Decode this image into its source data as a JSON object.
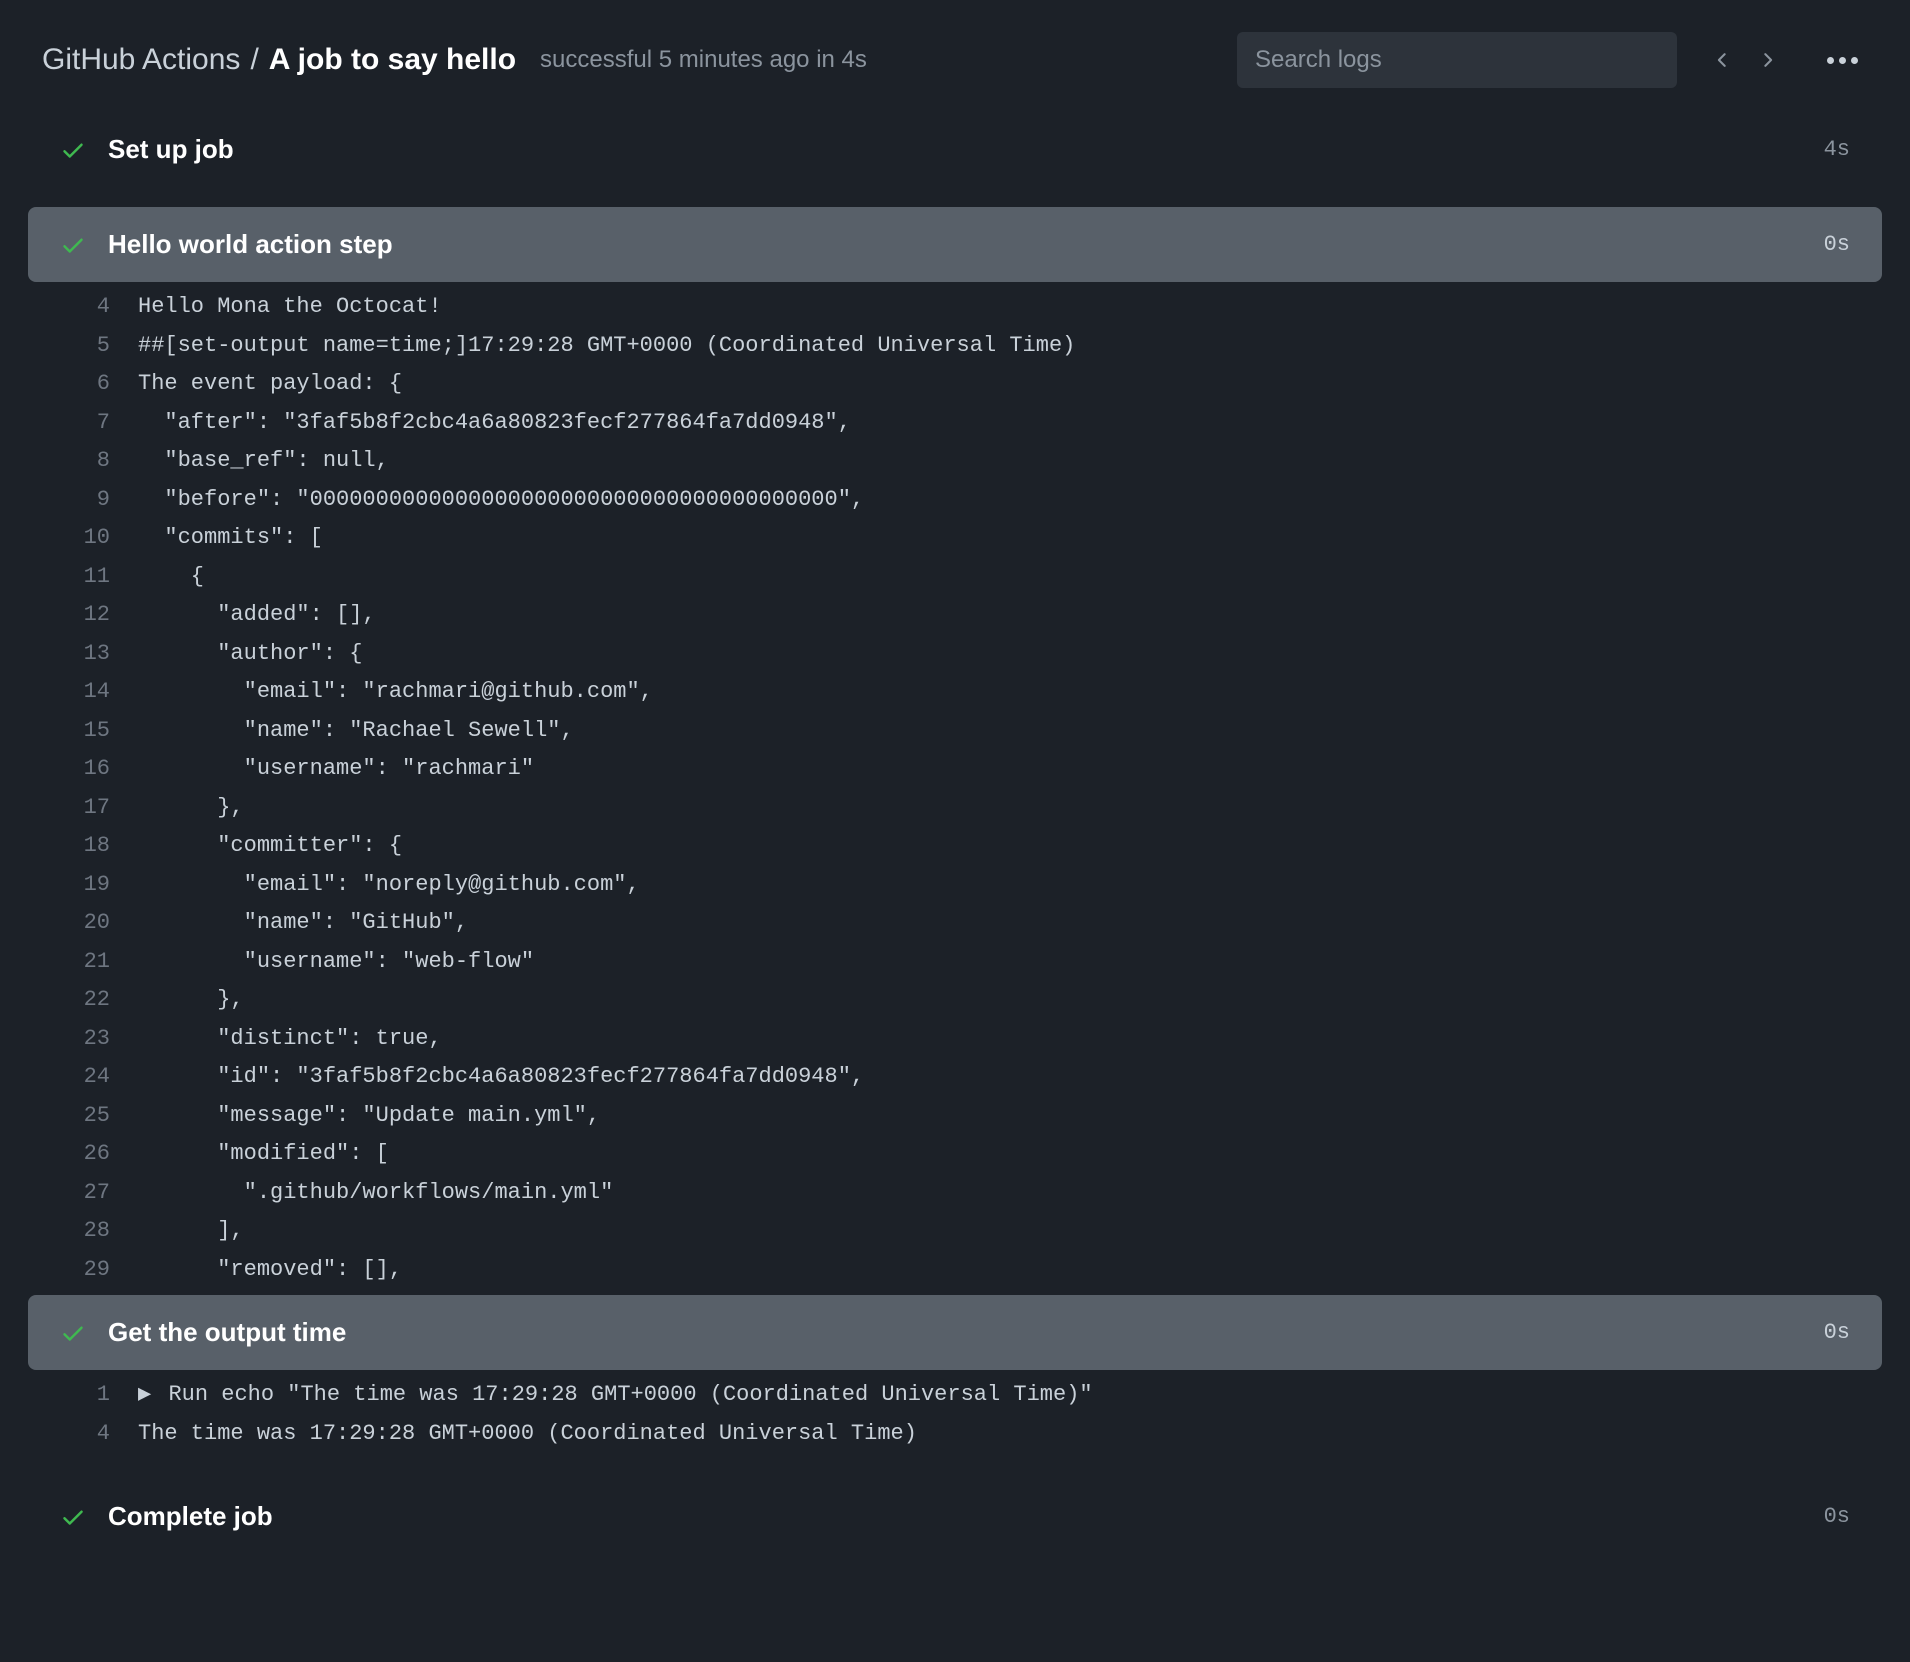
{
  "header": {
    "breadcrumb_parent": "GitHub Actions",
    "breadcrumb_sep": "/",
    "breadcrumb_current": "A job to say hello",
    "status": "successful 5 minutes ago in 4s",
    "search_placeholder": "Search logs"
  },
  "steps": [
    {
      "id": "setup",
      "title": "Set up job",
      "duration": "4s",
      "expanded": false
    },
    {
      "id": "hello",
      "title": "Hello world action step",
      "duration": "0s",
      "expanded": true,
      "lines": [
        {
          "n": "4",
          "t": "Hello Mona the Octocat!"
        },
        {
          "n": "5",
          "t": "##[set-output name=time;]17:29:28 GMT+0000 (Coordinated Universal Time)"
        },
        {
          "n": "6",
          "t": "The event payload: {"
        },
        {
          "n": "7",
          "t": "  \"after\": \"3faf5b8f2cbc4a6a80823fecf277864fa7dd0948\","
        },
        {
          "n": "8",
          "t": "  \"base_ref\": null,"
        },
        {
          "n": "9",
          "t": "  \"before\": \"0000000000000000000000000000000000000000\","
        },
        {
          "n": "10",
          "t": "  \"commits\": ["
        },
        {
          "n": "11",
          "t": "    {"
        },
        {
          "n": "12",
          "t": "      \"added\": [],"
        },
        {
          "n": "13",
          "t": "      \"author\": {"
        },
        {
          "n": "14",
          "t": "        \"email\": \"rachmari@github.com\","
        },
        {
          "n": "15",
          "t": "        \"name\": \"Rachael Sewell\","
        },
        {
          "n": "16",
          "t": "        \"username\": \"rachmari\""
        },
        {
          "n": "17",
          "t": "      },"
        },
        {
          "n": "18",
          "t": "      \"committer\": {"
        },
        {
          "n": "19",
          "t": "        \"email\": \"noreply@github.com\","
        },
        {
          "n": "20",
          "t": "        \"name\": \"GitHub\","
        },
        {
          "n": "21",
          "t": "        \"username\": \"web-flow\""
        },
        {
          "n": "22",
          "t": "      },"
        },
        {
          "n": "23",
          "t": "      \"distinct\": true,"
        },
        {
          "n": "24",
          "t": "      \"id\": \"3faf5b8f2cbc4a6a80823fecf277864fa7dd0948\","
        },
        {
          "n": "25",
          "t": "      \"message\": \"Update main.yml\","
        },
        {
          "n": "26",
          "t": "      \"modified\": ["
        },
        {
          "n": "27",
          "t": "        \".github/workflows/main.yml\""
        },
        {
          "n": "28",
          "t": "      ],"
        },
        {
          "n": "29",
          "t": "      \"removed\": [],"
        }
      ]
    },
    {
      "id": "output-time",
      "title": "Get the output time",
      "duration": "0s",
      "expanded": true,
      "lines": [
        {
          "n": "1",
          "d": true,
          "t": "Run echo \"The time was 17:29:28 GMT+0000 (Coordinated Universal Time)\""
        },
        {
          "n": "4",
          "t": "The time was 17:29:28 GMT+0000 (Coordinated Universal Time)"
        }
      ]
    },
    {
      "id": "complete",
      "title": "Complete job",
      "duration": "0s",
      "expanded": false
    }
  ]
}
